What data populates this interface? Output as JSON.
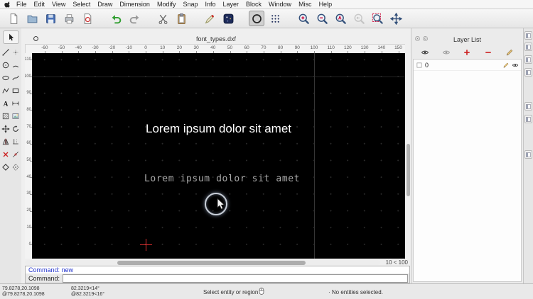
{
  "menu_bar": {
    "items": [
      "File",
      "Edit",
      "View",
      "Select",
      "Draw",
      "Dimension",
      "Modify",
      "Snap",
      "Info",
      "Layer",
      "Block",
      "Window",
      "Misc",
      "Help"
    ]
  },
  "toolbar": {
    "buttons": [
      {
        "name": "new-file",
        "icon": "doc-new"
      },
      {
        "name": "open-file",
        "icon": "folder-open"
      },
      {
        "name": "save-file",
        "icon": "floppy"
      },
      {
        "name": "print",
        "icon": "printer"
      },
      {
        "name": "print-preview",
        "icon": "doc-preview"
      },
      {
        "name": "undo",
        "icon": "undo"
      },
      {
        "name": "redo",
        "icon": "redo"
      },
      {
        "name": "cut",
        "icon": "scissors"
      },
      {
        "name": "paste",
        "icon": "clipboard"
      },
      {
        "name": "draw-order",
        "icon": "pen-red"
      },
      {
        "name": "snap-settings",
        "icon": "snap-navy"
      },
      {
        "name": "current-action-circle",
        "icon": "circle-tool",
        "selected": true
      },
      {
        "name": "grid-settings",
        "icon": "grid-dots"
      },
      {
        "name": "zoom-in",
        "icon": "zoom-in"
      },
      {
        "name": "zoom-out",
        "icon": "zoom-out"
      },
      {
        "name": "zoom-auto",
        "icon": "zoom-auto"
      },
      {
        "name": "zoom-previous",
        "icon": "zoom-prev",
        "disabled": true
      },
      {
        "name": "zoom-window",
        "icon": "zoom-window"
      },
      {
        "name": "zoom-pan",
        "icon": "zoom-pan"
      }
    ]
  },
  "left_toolbar": {
    "selection_tool": "arrow-cursor",
    "rows": [
      [
        "line",
        "point"
      ],
      [
        "circle",
        "arc"
      ],
      [
        "ellipse",
        "spline"
      ],
      [
        "polyline",
        "rect"
      ],
      [
        "text",
        "dimension"
      ],
      [
        "hatch",
        "image"
      ],
      [
        "move",
        "rotate"
      ],
      [
        "mirror",
        "trim"
      ],
      [
        "delete",
        "divide"
      ],
      [
        "block",
        "explode"
      ]
    ]
  },
  "canvas": {
    "doc_title": "font_types.dxf",
    "ruler_top_values": [
      -60,
      -50,
      -40,
      -30,
      -20,
      -10,
      0,
      10,
      20,
      30,
      40,
      50,
      60,
      70,
      80,
      90,
      100,
      110,
      120,
      130,
      140,
      150
    ],
    "ruler_left_values": [
      110,
      100,
      90,
      80,
      70,
      60,
      50,
      40,
      30,
      20,
      10,
      0
    ],
    "text_normal": "Lorem ipsum dolor sit amet",
    "text_cad": "Lorem ipsum dolor sit amet",
    "grid_status": "10 < 100"
  },
  "layer_list": {
    "title": "Layer List",
    "toolbar": [
      {
        "name": "show-all-layers",
        "icon": "eye"
      },
      {
        "name": "hide-all-layers",
        "icon": "eye-gray"
      },
      {
        "name": "add-layer",
        "icon": "plus-red"
      },
      {
        "name": "remove-layer",
        "icon": "minus-red"
      },
      {
        "name": "edit-layer",
        "icon": "pencil"
      }
    ],
    "layers": [
      {
        "name": "0"
      }
    ]
  },
  "right_strip": {
    "buttons": [
      "dock-toggle-1",
      "dock-toggle-2",
      "dock-toggle-3",
      "dock-toggle-4",
      "dock-toggle-5",
      "dock-toggle-6",
      "dock-toggle-7"
    ]
  },
  "command": {
    "history": "Command: new",
    "prompt": "Command:",
    "input_value": ""
  },
  "status_bar": {
    "coord_abs": "79.8278,20.1098",
    "coord_rel": "@79.8278,20.1098",
    "polar_abs": "82.3219<14°",
    "polar_rel": "@82.3219<16°",
    "hint": "Select entity or region",
    "selection": "· No entities selected."
  },
  "colors": {
    "canvas_bg": "#000000",
    "crosshair": "#e03030",
    "command_text": "#2233cc"
  }
}
